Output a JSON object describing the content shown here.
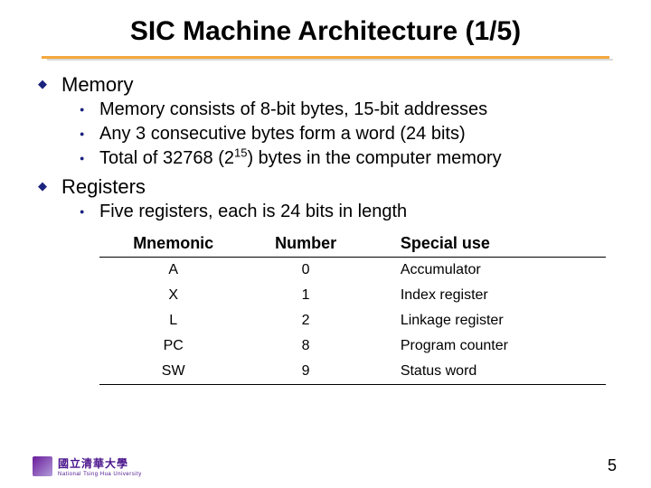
{
  "title": "SIC Machine Architecture (1/5)",
  "sections": {
    "memory": {
      "heading": "Memory",
      "items": [
        "Memory consists of 8-bit bytes, 15-bit addresses",
        "Any 3 consecutive bytes form a word (24 bits)",
        "Total of 32768 (2^15) bytes in the computer memory"
      ]
    },
    "registers": {
      "heading": "Registers",
      "items": [
        "Five registers, each is 24 bits in length"
      ],
      "table": {
        "headers": [
          "Mnemonic",
          "Number",
          "Special use"
        ],
        "rows": [
          [
            "A",
            "0",
            "Accumulator"
          ],
          [
            "X",
            "1",
            "Index register"
          ],
          [
            "L",
            "2",
            "Linkage register"
          ],
          [
            "PC",
            "8",
            "Program counter"
          ],
          [
            "SW",
            "9",
            "Status word"
          ]
        ]
      }
    }
  },
  "footer": {
    "uni_cn": "國立清華大學",
    "uni_en": "National Tsing Hua University"
  },
  "page_number": "5"
}
